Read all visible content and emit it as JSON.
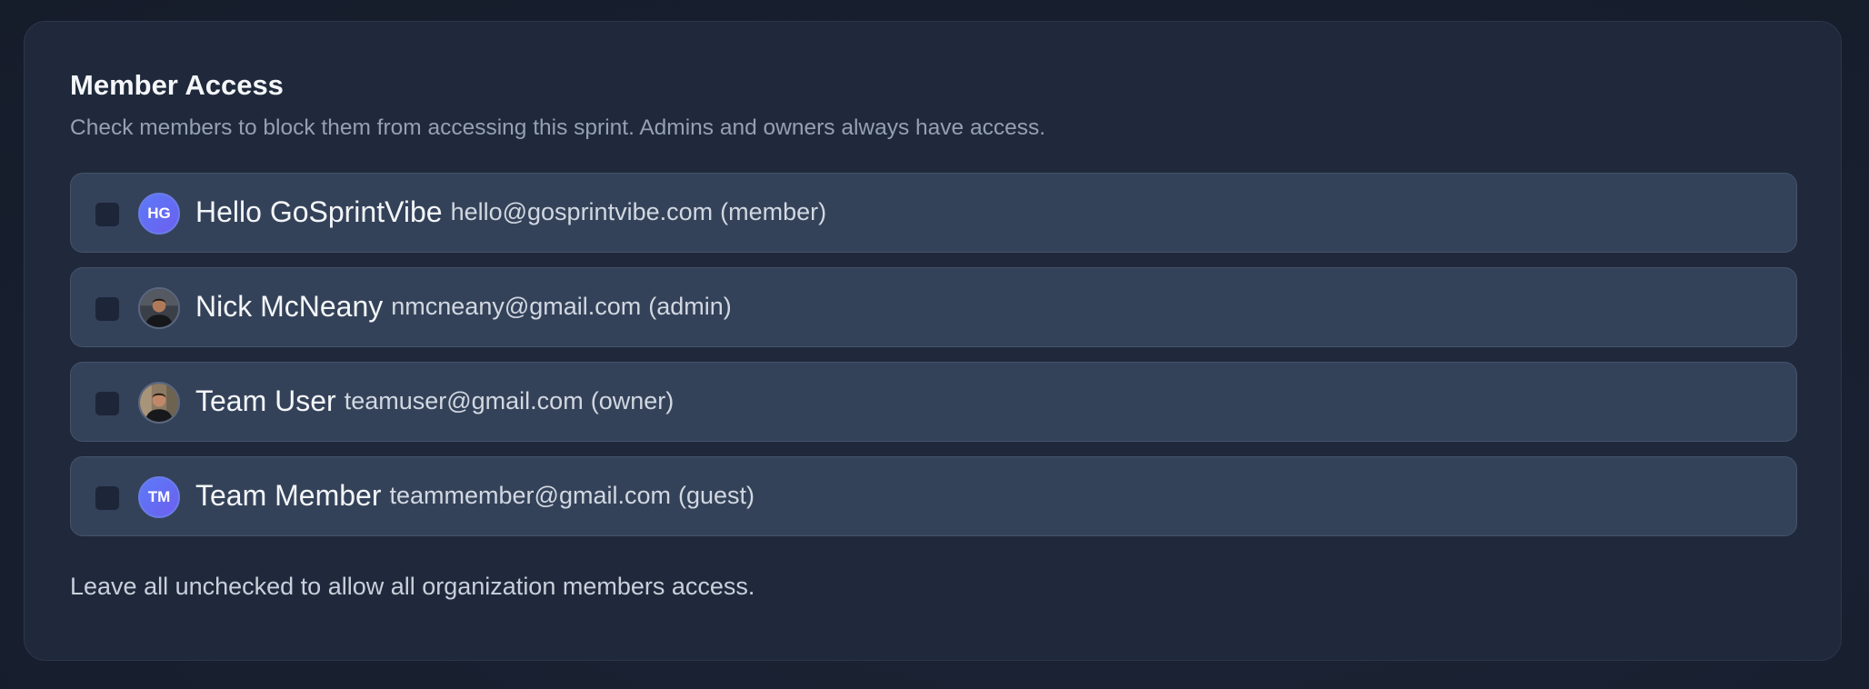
{
  "section": {
    "title": "Member Access",
    "subtitle": "Check members to block them from accessing this sprint. Admins and owners always have access.",
    "footnote": "Leave all unchecked to allow all organization members access."
  },
  "members": [
    {
      "name": "Hello GoSprintVibe",
      "email": "hello@gosprintvibe.com",
      "role": "(member)",
      "initials": "HG",
      "avatar_type": "initials",
      "checked": false
    },
    {
      "name": "Nick McNeany",
      "email": "nmcneany@gmail.com",
      "role": "(admin)",
      "avatar_type": "photo",
      "checked": false
    },
    {
      "name": "Team User",
      "email": "teamuser@gmail.com",
      "role": "(owner)",
      "avatar_type": "photo",
      "checked": false
    },
    {
      "name": "Team Member",
      "email": "teammember@gmail.com",
      "role": "(guest)",
      "initials": "TM",
      "avatar_type": "initials",
      "checked": false
    }
  ],
  "colors": {
    "background": "#182030",
    "card": "#1f293b",
    "row": "#344259",
    "avatar_gradient_start": "#5b7af7",
    "avatar_gradient_end": "#6d5ff0"
  },
  "icons": {
    "checkbox": "checkbox-unchecked-icon",
    "avatar_photo": "user-photo-avatar"
  }
}
